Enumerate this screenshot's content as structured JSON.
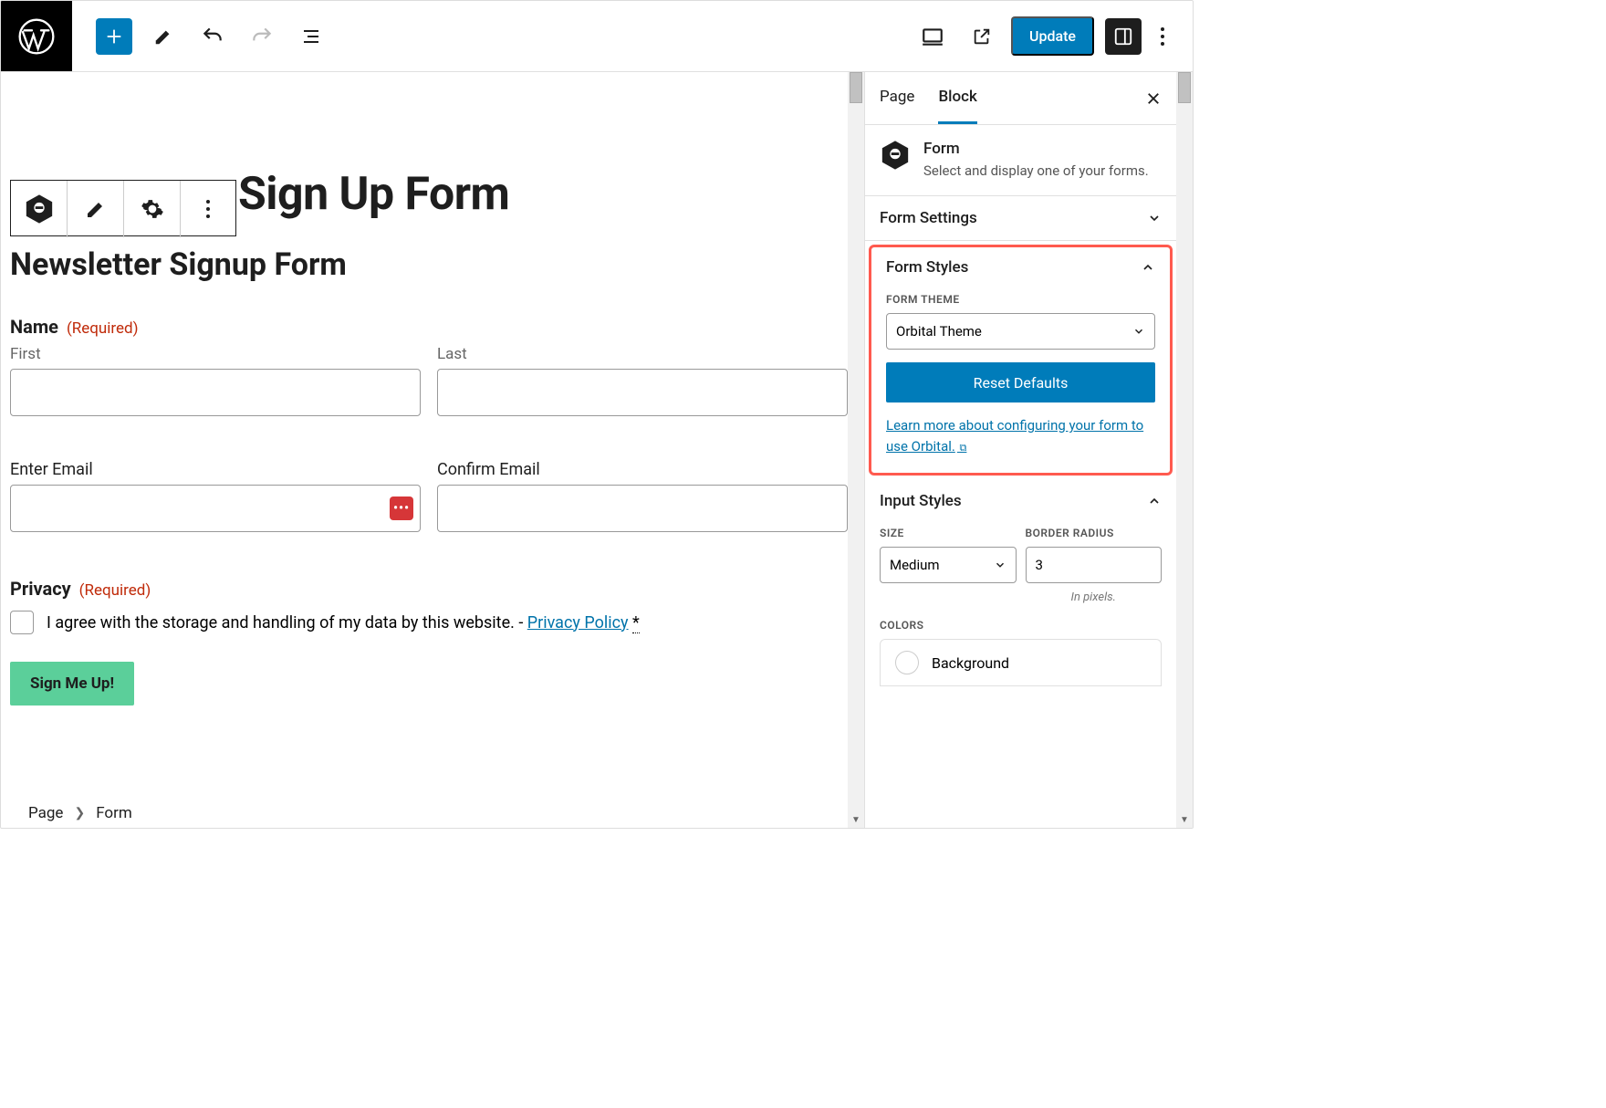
{
  "topbar": {
    "update_label": "Update"
  },
  "canvas": {
    "page_title_visible": "Sign Up Form",
    "form_title": "Newsletter Signup Form",
    "name": {
      "label": "Name",
      "required": "(Required)",
      "first_label": "First",
      "last_label": "Last"
    },
    "email": {
      "enter_label": "Enter Email",
      "confirm_label": "Confirm Email"
    },
    "privacy": {
      "label": "Privacy",
      "required": "(Required)",
      "consent_text": "I agree with the storage and handling of my data by this website. - ",
      "policy_link": "Privacy Policy",
      "asterisk": "*"
    },
    "submit_label": "Sign Me Up!"
  },
  "breadcrumb": {
    "root": "Page",
    "current": "Form"
  },
  "sidebar": {
    "tabs": {
      "page": "Page",
      "block": "Block"
    },
    "block_header": {
      "title": "Form",
      "description": "Select and display one of your forms."
    },
    "form_settings": {
      "title": "Form Settings"
    },
    "form_styles": {
      "title": "Form Styles",
      "theme_label": "FORM THEME",
      "theme_value": "Orbital Theme",
      "reset_label": "Reset Defaults",
      "learn_link": "Learn more about configuring your form to use Orbital."
    },
    "input_styles": {
      "title": "Input Styles",
      "size_label": "SIZE",
      "size_value": "Medium",
      "radius_label": "BORDER RADIUS",
      "radius_value": "3",
      "radius_hint": "In pixels.",
      "colors_label": "COLORS",
      "color_background": "Background"
    }
  }
}
